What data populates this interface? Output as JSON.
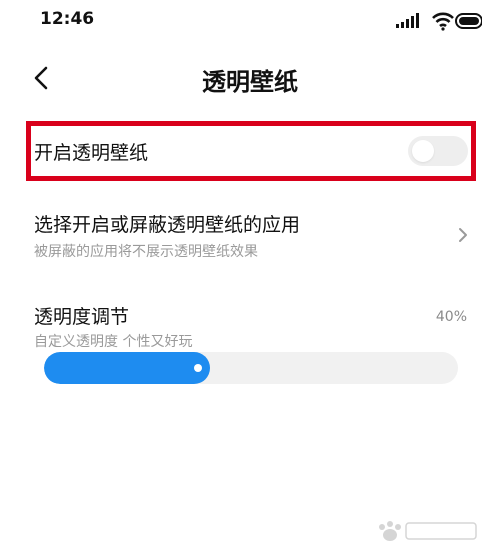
{
  "status_bar": {
    "time": "12:46",
    "icons": [
      "signal-icon",
      "wifi-icon",
      "battery-icon"
    ]
  },
  "header": {
    "back_icon": "back-arrow-icon",
    "title": "透明壁纸"
  },
  "toggle_row": {
    "label": "开启透明壁纸",
    "enabled": false,
    "highlight_color": "#d9001b"
  },
  "app_select_row": {
    "title": "选择开启或屏蔽透明壁纸的应用",
    "subtitle": "被屏蔽的应用将不展示透明壁纸效果",
    "icon": "chevron-right-icon"
  },
  "opacity": {
    "title": "透明度调节",
    "subtitle": "自定义透明度 个性又好玩",
    "value_label": "40%",
    "value": 0.4,
    "accent_color": "#1e8cf0"
  },
  "watermark": {
    "icon": "baidu-watermark-icon"
  }
}
